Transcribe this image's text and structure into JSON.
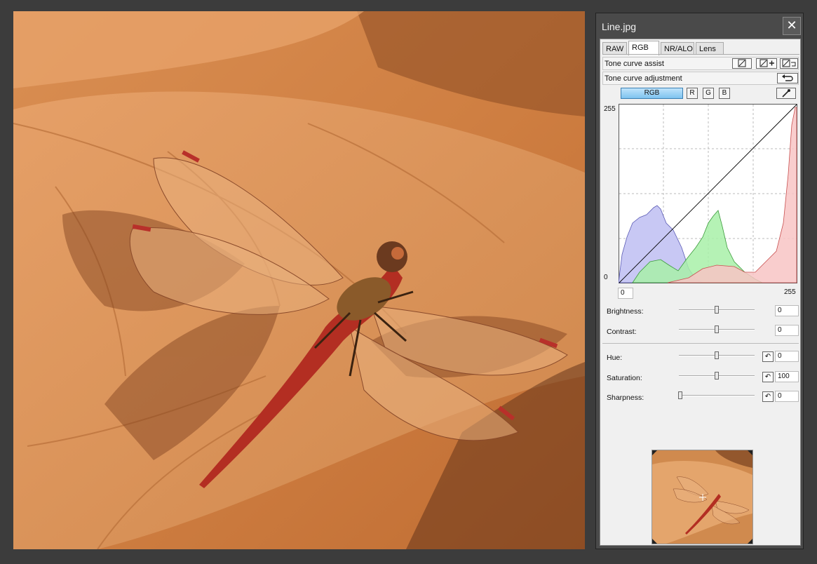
{
  "window": {
    "title": "Line.jpg",
    "close_icon": "close-icon"
  },
  "tabs": [
    {
      "label": "RAW",
      "active": false
    },
    {
      "label": "RGB",
      "active": true
    },
    {
      "label": "NR/ALO",
      "active": false
    },
    {
      "label": "Lens",
      "active": false
    }
  ],
  "tone_curve_assist": {
    "label": "Tone curve assist",
    "icons": [
      "curve-linear-icon",
      "curve-add-icon",
      "curve-reset-icon"
    ]
  },
  "tone_curve_adjustment": {
    "label": "Tone curve adjustment",
    "icon": "undo-icon"
  },
  "channels": {
    "buttons": [
      "RGB",
      "R",
      "G",
      "B"
    ],
    "selected": "RGB",
    "picker_icon": "eyedropper-icon"
  },
  "histogram": {
    "y_top_label": "255",
    "y_bottom_label": "0",
    "input_low": "0",
    "input_high": "255",
    "colors": {
      "blue": "#c8c8f4",
      "green": "#a8f0a8",
      "red": "#f8c4c4"
    }
  },
  "adjustments": [
    {
      "label": "Brightness:",
      "value": "0",
      "level": 0.5,
      "reset": false
    },
    {
      "label": "Contrast:",
      "value": "0",
      "level": 0.5,
      "reset": false
    },
    {
      "label": "Hue:",
      "value": "0",
      "level": 0.5,
      "reset": true
    },
    {
      "label": "Saturation:",
      "value": "100",
      "level": 0.5,
      "reset": true
    },
    {
      "label": "Sharpness:",
      "value": "0",
      "level": 0.0,
      "reset": true
    }
  ],
  "navigator": {
    "crosshair_icon": "crosshair-icon"
  }
}
